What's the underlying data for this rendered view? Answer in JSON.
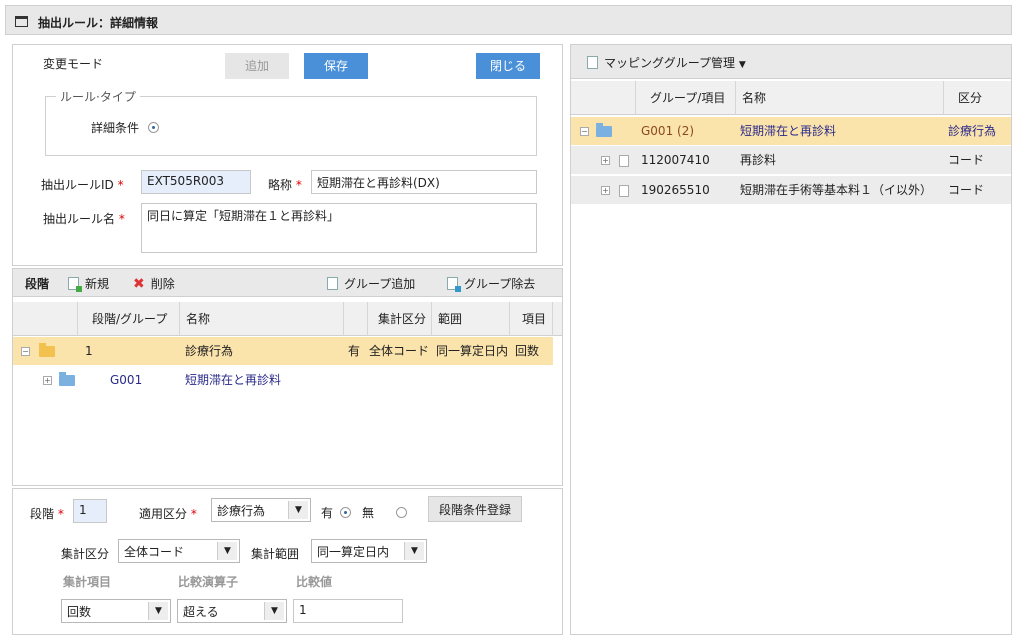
{
  "window": {
    "title": "抽出ルール：詳細情報"
  },
  "form": {
    "mode_label": "変更モード",
    "add_button": "追加",
    "save_button": "保存",
    "close_button": "閉じる",
    "rule_type_legend": "ルール·タイプ",
    "rule_type_option": "詳細条件",
    "rule_id_label": "抽出ルールID",
    "rule_id_value": "EXT505R003",
    "abbrev_label": "略称",
    "abbrev_value": "短期滞在と再診料(DX)",
    "rule_name_label": "抽出ルール名",
    "rule_name_value": "同日に算定「短期滞在１と再診料」",
    "required_mark": "*"
  },
  "stage_toolbar": {
    "title": "段階",
    "new": "新規",
    "delete": "削除",
    "group_add": "グループ追加",
    "group_remove": "グループ除去"
  },
  "stage_grid": {
    "columns": [
      "段階/グループ",
      "名称",
      "",
      "集計区分",
      "範囲",
      "項目"
    ],
    "rows": [
      {
        "stage": "1",
        "name": "診療行為",
        "flag": "有",
        "agg": "全体コード",
        "range": "同一算定日内",
        "item": "回数"
      }
    ],
    "child": {
      "group": "G001",
      "name": "短期滞在と再診料"
    }
  },
  "stage_form": {
    "stage_label": "段階",
    "stage_value": "1",
    "apply_label": "適用区分",
    "apply_value": "診療行為",
    "yes_label": "有",
    "no_label": "無",
    "register_button": "段階条件登録",
    "agg_type_label": "集計区分",
    "agg_type_value": "全体コード",
    "agg_range_label": "集計範囲",
    "agg_range_value": "同一算定日内",
    "agg_item_label": "集計項目",
    "op_label": "比較演算子",
    "cmp_label": "比較値",
    "agg_item_value": "回数",
    "op_value": "超える",
    "cmp_value": "1"
  },
  "mapping": {
    "title": "マッピンググループ管理",
    "columns": [
      "グループ/項目",
      "名称",
      "区分"
    ],
    "rows": [
      {
        "code": "G001 (2)",
        "name": "短期滞在と再診料",
        "kind": "診療行為"
      },
      {
        "code": "112007410",
        "name": "再診料",
        "kind": "コード"
      },
      {
        "code": "190265510",
        "name": "短期滞在手術等基本料１（イ以外）",
        "kind": "コード"
      }
    ]
  }
}
